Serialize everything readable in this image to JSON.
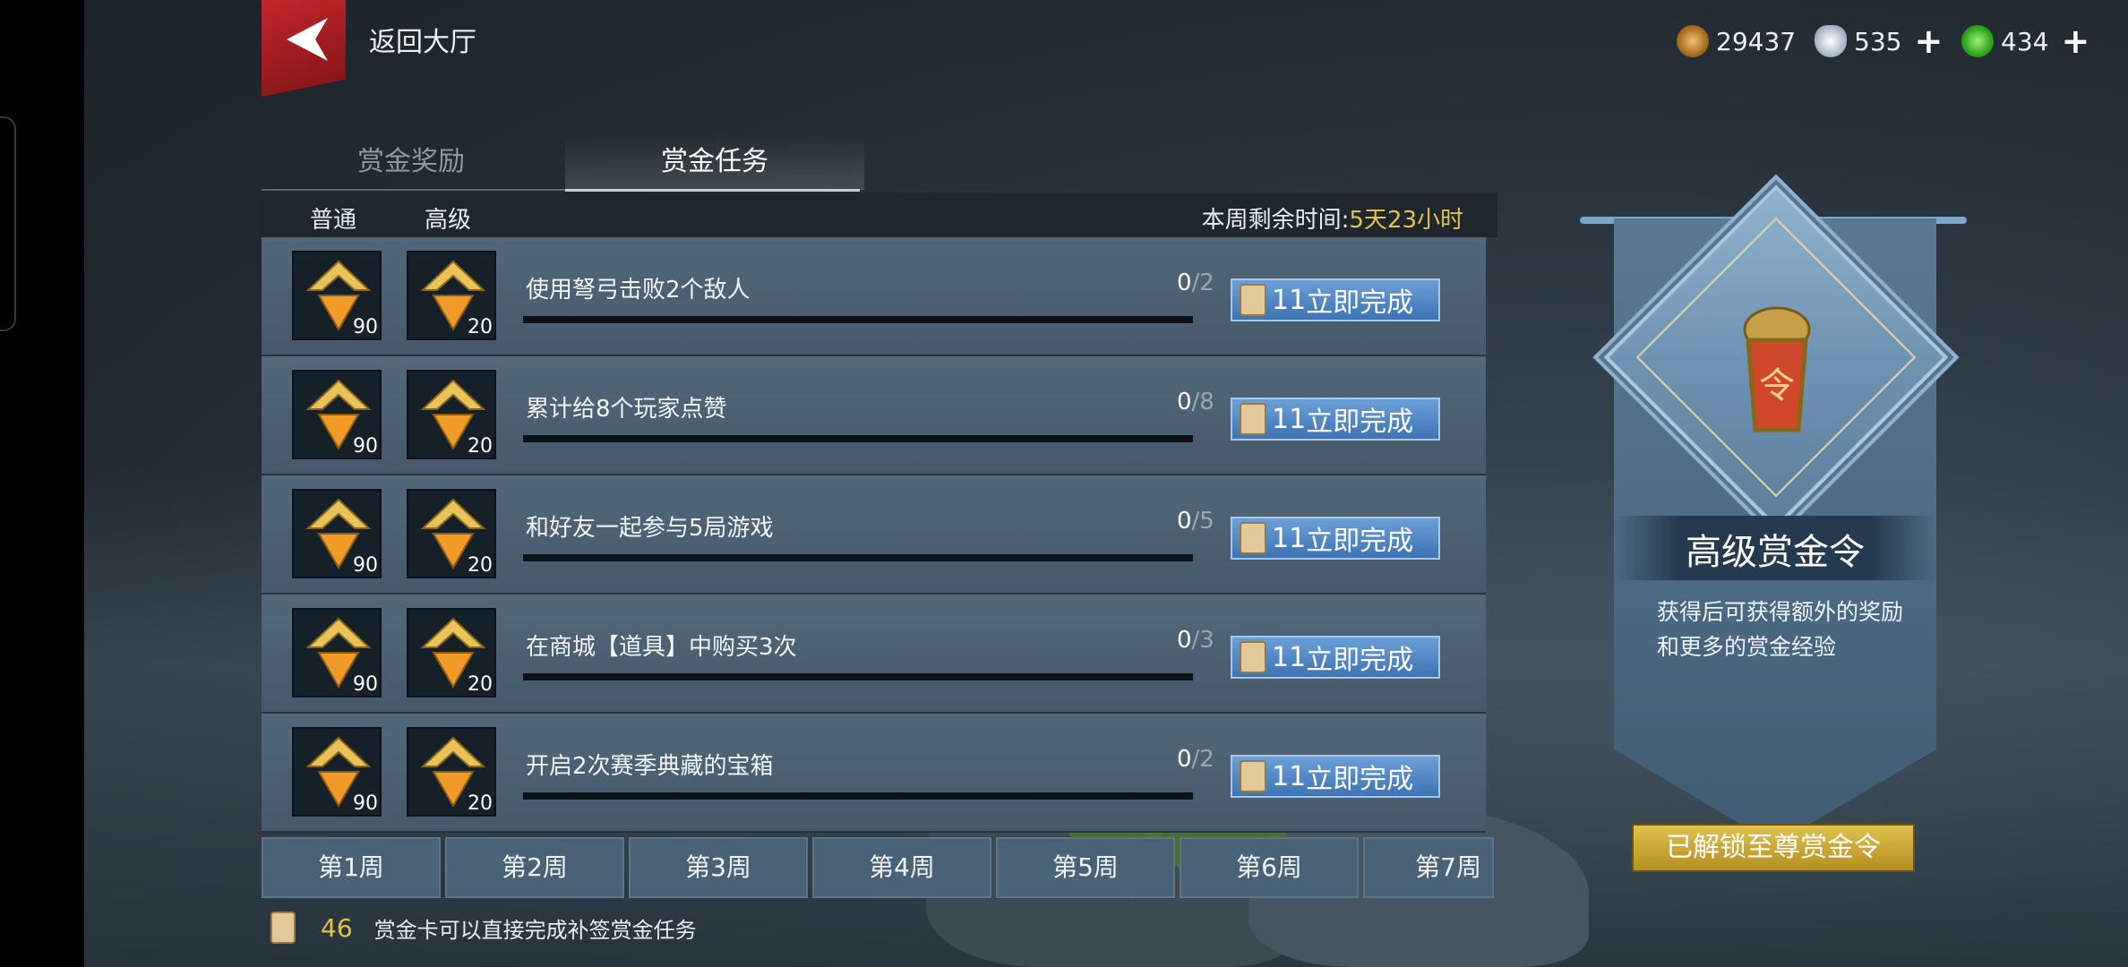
{
  "header": {
    "back_label": "返回大厅",
    "currencies": [
      {
        "icon": "copper-coin-icon",
        "value": "29437",
        "color": "#c8923a",
        "has_plus": false
      },
      {
        "icon": "silver-ingot-icon",
        "value": "535",
        "color": "#b8c4d0",
        "has_plus": true
      },
      {
        "icon": "jade-coin-icon",
        "value": "434",
        "color": "#3fb52a",
        "has_plus": true
      }
    ]
  },
  "tabs": [
    {
      "label": "赏金奖励",
      "active": false
    },
    {
      "label": "赏金任务",
      "active": true
    }
  ],
  "task_header": {
    "col_normal": "普通",
    "col_advanced": "高级",
    "week_remaining_label": "本周剩余时间:",
    "week_remaining_value": "5天23小时"
  },
  "tasks": [
    {
      "name": "使用弩弓击败2个敌人",
      "done": "0",
      "total": "/2",
      "normal_reward": "90",
      "advanced_reward": "20",
      "cost": "11",
      "button": "立即完成"
    },
    {
      "name": "累计给8个玩家点赞",
      "done": "0",
      "total": "/8",
      "normal_reward": "90",
      "advanced_reward": "20",
      "cost": "11",
      "button": "立即完成"
    },
    {
      "name": "和好友一起参与5局游戏",
      "done": "0",
      "total": "/5",
      "normal_reward": "90",
      "advanced_reward": "20",
      "cost": "11",
      "button": "立即完成"
    },
    {
      "name": "在商城【道具】中购买3次",
      "done": "0",
      "total": "/3",
      "normal_reward": "90",
      "advanced_reward": "20",
      "cost": "11",
      "button": "立即完成"
    },
    {
      "name": "开启2次赛季典藏的宝箱",
      "done": "0",
      "total": "/2",
      "normal_reward": "90",
      "advanced_reward": "20",
      "cost": "11",
      "button": "立即完成"
    }
  ],
  "weeks": [
    "第1周",
    "第2周",
    "第3周",
    "第4周",
    "第5周",
    "第6周",
    "第7周"
  ],
  "footer": {
    "ticket_count": "46",
    "note": "赏金卡可以直接完成补签赏金任务"
  },
  "banner": {
    "token_glyph": "令",
    "title": "高级赏金令",
    "description": "获得后可获得额外的奖励和更多的赏金经验",
    "unlock_button": "已解锁至尊赏金令"
  }
}
